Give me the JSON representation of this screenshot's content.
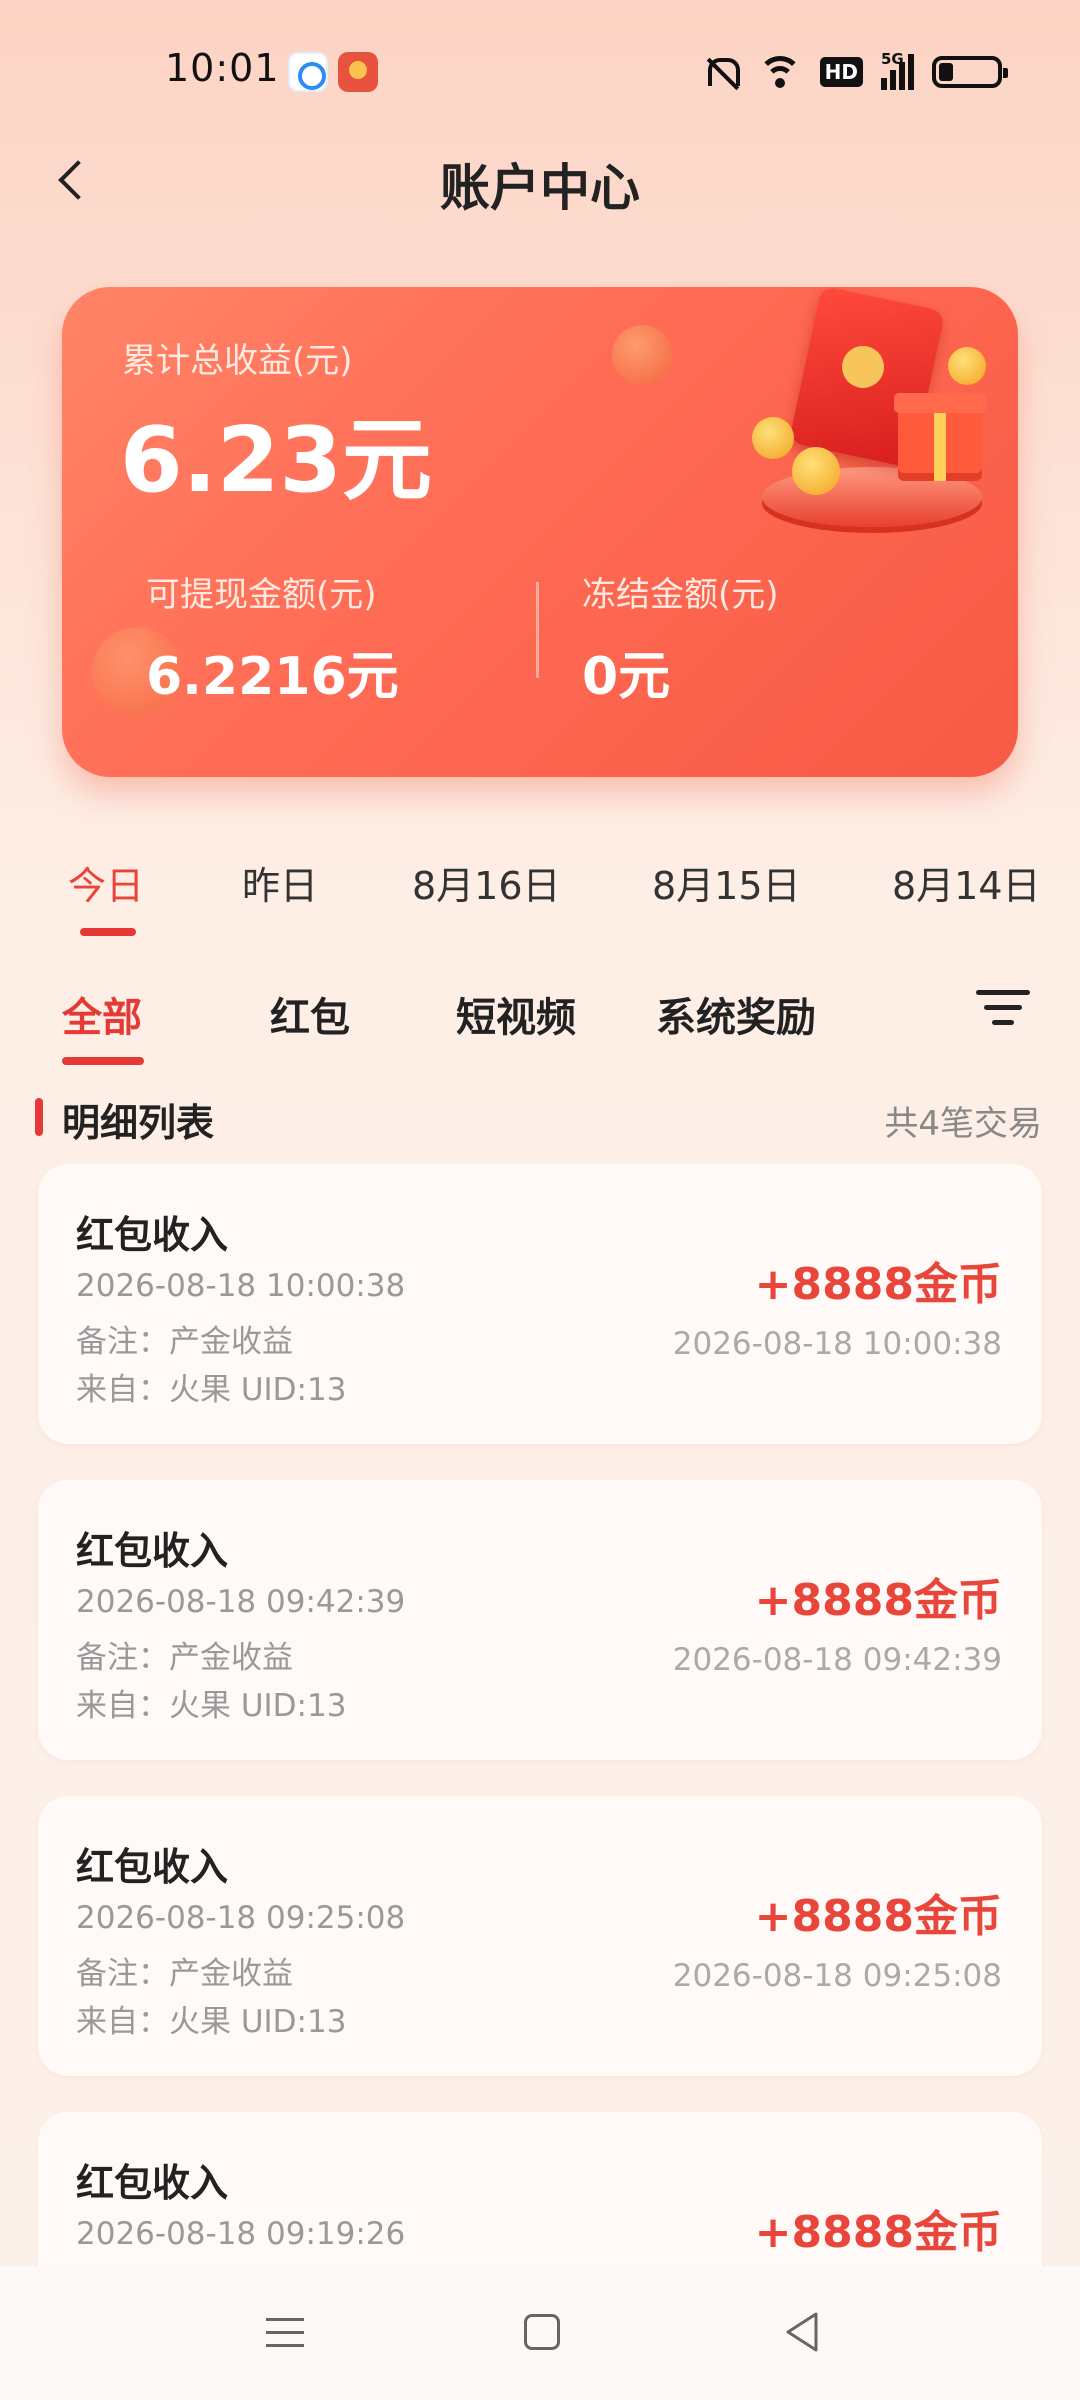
{
  "status_bar": {
    "time": "10:01",
    "network_tag": "5G",
    "hd_label": "HD"
  },
  "header": {
    "title": "账户中心"
  },
  "summary": {
    "total_label": "累计总收益(元)",
    "total_value": "6.23元",
    "withdrawable_label": "可提现金额(元)",
    "withdrawable_value": "6.2216元",
    "frozen_label": "冻结金额(元)",
    "frozen_value": "0元"
  },
  "date_tabs": [
    "今日",
    "昨日",
    "8月16日",
    "8月15日",
    "8月14日"
  ],
  "category_tabs": [
    "全部",
    "红包",
    "短视频",
    "系统奖励"
  ],
  "list": {
    "title": "明细列表",
    "count": "共4笔交易"
  },
  "records": [
    {
      "title": "红包收入",
      "time": "2026-08-18 10:00:38",
      "note": "备注：产金收益",
      "source": "来自：火果 UID:13",
      "amount": "+8888金币"
    },
    {
      "title": "红包收入",
      "time": "2026-08-18 09:42:39",
      "note": "备注：产金收益",
      "source": "来自：火果 UID:13",
      "amount": "+8888金币"
    },
    {
      "title": "红包收入",
      "time": "2026-08-18 09:25:08",
      "note": "备注：产金收益",
      "source": "来自：火果 UID:13",
      "amount": "+8888金币"
    },
    {
      "title": "红包收入",
      "time": "2026-08-18 09:19:26",
      "amount": "+8888金币"
    }
  ],
  "colors": {
    "accent": "#e53935",
    "card_start": "#ff8467",
    "card_end": "#f75a45"
  }
}
